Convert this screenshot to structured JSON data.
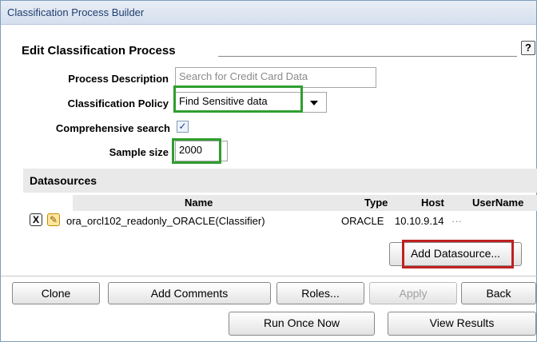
{
  "window": {
    "title": "Classification Process Builder"
  },
  "section": {
    "title": "Edit Classification Process",
    "help_glyph": "?"
  },
  "form": {
    "process_description": {
      "label": "Process Description",
      "placeholder": "Search for Credit Card Data"
    },
    "classification_policy": {
      "label": "Classification Policy",
      "value": "Find Sensitive data"
    },
    "comprehensive_search": {
      "label": "Comprehensive search",
      "checked": true,
      "glyph": "✓"
    },
    "sample_size": {
      "label": "Sample size",
      "value": "2000"
    }
  },
  "datasources": {
    "title": "Datasources",
    "columns": [
      "Name",
      "Type",
      "Host",
      "UserName"
    ],
    "rows": [
      {
        "remove_glyph": "X",
        "edit_glyph": "✎",
        "name": "ora_orcl102_readonly_ORACLE(Classifier)",
        "type": "ORACLE",
        "host": "10.10.9.14",
        "username": "···"
      }
    ],
    "add_button": "Add Datasource..."
  },
  "actions": {
    "clone": "Clone",
    "add_comments": "Add Comments",
    "roles": "Roles...",
    "apply": "Apply",
    "back": "Back",
    "run_once": "Run Once Now",
    "view_results": "View Results"
  },
  "colors": {
    "highlight_green": "#2f9e2f",
    "highlight_red": "#c02020",
    "title_text": "#1f3e6e"
  }
}
